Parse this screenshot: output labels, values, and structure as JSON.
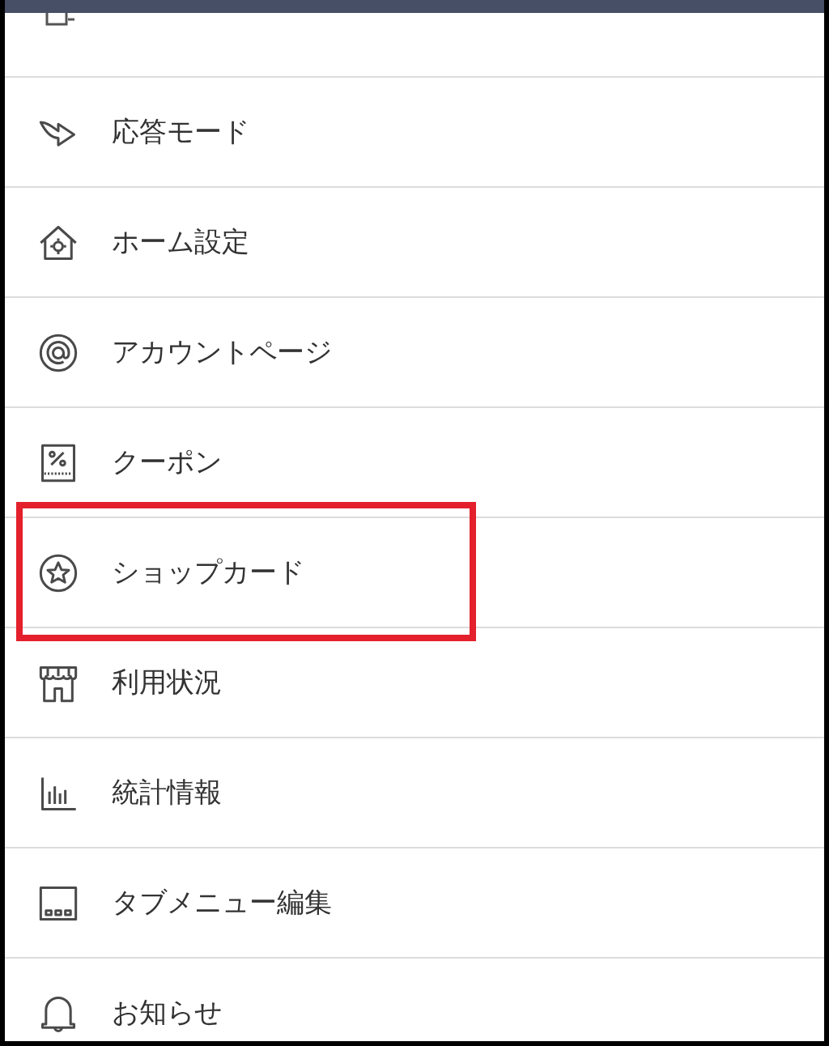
{
  "menu": {
    "items": [
      {
        "label": "応答モード",
        "highlighted": false
      },
      {
        "label": "ホーム設定",
        "highlighted": false
      },
      {
        "label": "アカウントページ",
        "highlighted": false
      },
      {
        "label": "クーポン",
        "highlighted": false
      },
      {
        "label": "ショップカード",
        "highlighted": true
      },
      {
        "label": "利用状況",
        "highlighted": false
      },
      {
        "label": "統計情報",
        "highlighted": false
      },
      {
        "label": "タブメニュー編集",
        "highlighted": false
      },
      {
        "label": "お知らせ",
        "highlighted": false
      }
    ]
  }
}
